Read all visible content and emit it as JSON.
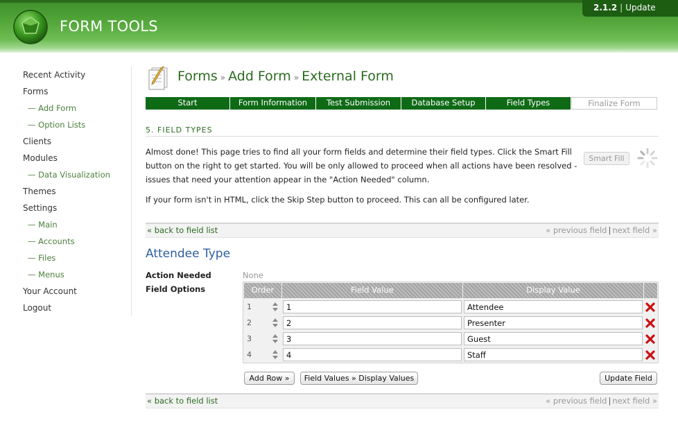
{
  "header": {
    "app_name": "FORM TOOLS",
    "version": "2.1.2",
    "update_label": "Update",
    "separator": "|"
  },
  "sidebar": {
    "items": [
      {
        "label": "Recent Activity",
        "sub": false
      },
      {
        "label": "Forms",
        "sub": false
      },
      {
        "label": "— Add Form",
        "sub": true
      },
      {
        "label": "— Option Lists",
        "sub": true
      },
      {
        "label": "Clients",
        "sub": false
      },
      {
        "label": "Modules",
        "sub": false
      },
      {
        "label": "— Data Visualization",
        "sub": true
      },
      {
        "label": "Themes",
        "sub": false
      },
      {
        "label": "Settings",
        "sub": false
      },
      {
        "label": "— Main",
        "sub": true
      },
      {
        "label": "— Accounts",
        "sub": true
      },
      {
        "label": "— Files",
        "sub": true
      },
      {
        "label": "— Menus",
        "sub": true
      },
      {
        "label": "Your Account",
        "sub": false
      },
      {
        "label": "Logout",
        "sub": false
      }
    ]
  },
  "breadcrumb": {
    "crumb1": "Forms",
    "crumb2": "Add Form",
    "crumb3": "External Form",
    "sep": "»"
  },
  "steps": [
    {
      "label": "Start",
      "active": true
    },
    {
      "label": "Form Information",
      "active": true
    },
    {
      "label": "Test Submission",
      "active": true
    },
    {
      "label": "Database Setup",
      "active": true
    },
    {
      "label": "Field Types",
      "active": true
    },
    {
      "label": "Finalize Form",
      "active": false
    }
  ],
  "section_title": "5. FIELD TYPES",
  "intro": {
    "para1": "Almost done! This page tries to find all your form fields and determine their field types. Click the Smart Fill button on the right to get started. You will be only allowed to proceed when all actions have been resolved - issues that need your attention appear in the \"Action Needed\" column.",
    "para2": "If your form isn't in HTML, click the Skip Step button to proceed. This can all be configured later."
  },
  "smart_fill_label": "Smart Fill",
  "nav": {
    "back": "« back to field list",
    "previous": "« previous field",
    "next": "next field »",
    "sep": "|"
  },
  "field": {
    "title": "Attendee Type",
    "action_needed_label": "Action Needed",
    "action_needed_value": "None",
    "field_options_label": "Field Options"
  },
  "options_table": {
    "headers": {
      "order": "Order",
      "field_value": "Field Value",
      "display_value": "Display Value"
    },
    "rows": [
      {
        "order": "1",
        "field_value": "1",
        "display_value": "Attendee"
      },
      {
        "order": "2",
        "field_value": "2",
        "display_value": "Presenter"
      },
      {
        "order": "3",
        "field_value": "3",
        "display_value": "Guest"
      },
      {
        "order": "4",
        "field_value": "4",
        "display_value": "Staff"
      }
    ]
  },
  "buttons": {
    "add_row": "Add Row »",
    "field_values_display": "Field Values » Display Values",
    "update_field": "Update Field"
  },
  "colors": {
    "brand_green": "#0f6a16",
    "link_green": "#2b6a1f",
    "heading_blue": "#2c5fa0",
    "delete_red": "#cc1111"
  }
}
